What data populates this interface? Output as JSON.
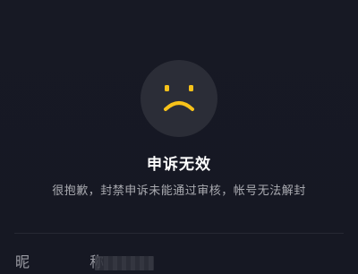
{
  "status": {
    "icon": "sad-face-icon",
    "title": "申诉无效",
    "message": "很抱歉，封禁申诉未能通过审核，帐号无法解封"
  },
  "account_info": {
    "nickname_label": "昵 称",
    "nickname_value_state": "obscured"
  },
  "colors": {
    "background": "#161823",
    "icon_circle": "#2b2d37",
    "icon_face": "#f7c21a",
    "title": "#ffffff",
    "message": "#a9aab0"
  }
}
